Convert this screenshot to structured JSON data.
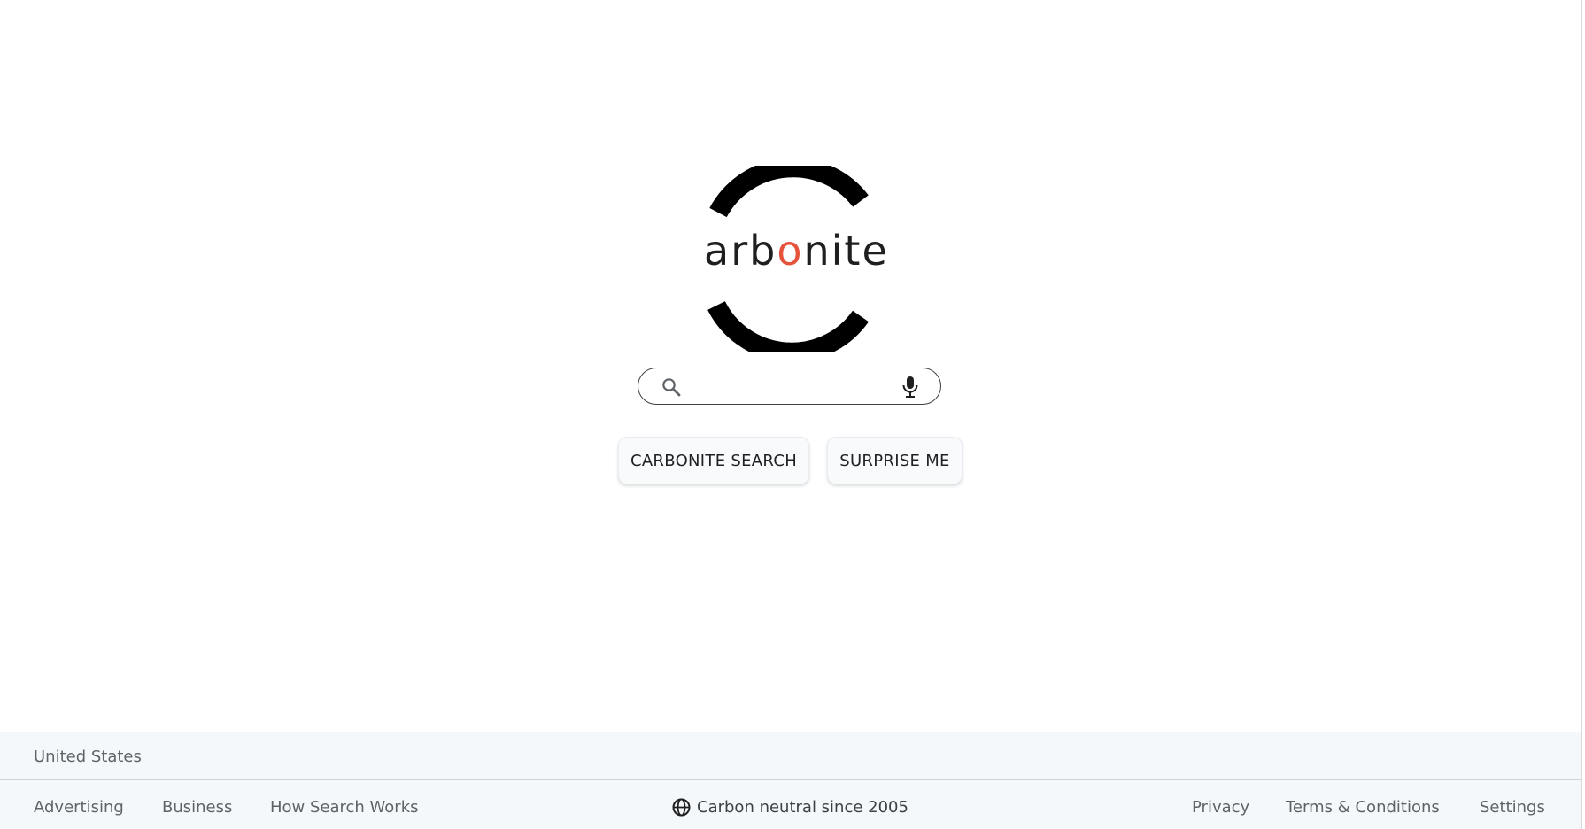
{
  "logo": {
    "text_before": "arb",
    "text_accent": "o",
    "text_after": "nite",
    "accent_color": "#e5533c",
    "arc_color": "#000000"
  },
  "search": {
    "value": "",
    "placeholder": "",
    "search_icon": "search-icon",
    "mic_icon": "mic-icon"
  },
  "buttons": {
    "primary_label": "CARBONITE SEARCH",
    "secondary_label": "SURPRISE ME"
  },
  "footer": {
    "country": "United States",
    "left_links": [
      "Advertising",
      "Business",
      "How Search Works"
    ],
    "carbon_icon": "globe-icon",
    "carbon_text": "Carbon neutral since 2005",
    "right_links": [
      "Privacy",
      "Terms & Conditions",
      "Settings"
    ]
  }
}
